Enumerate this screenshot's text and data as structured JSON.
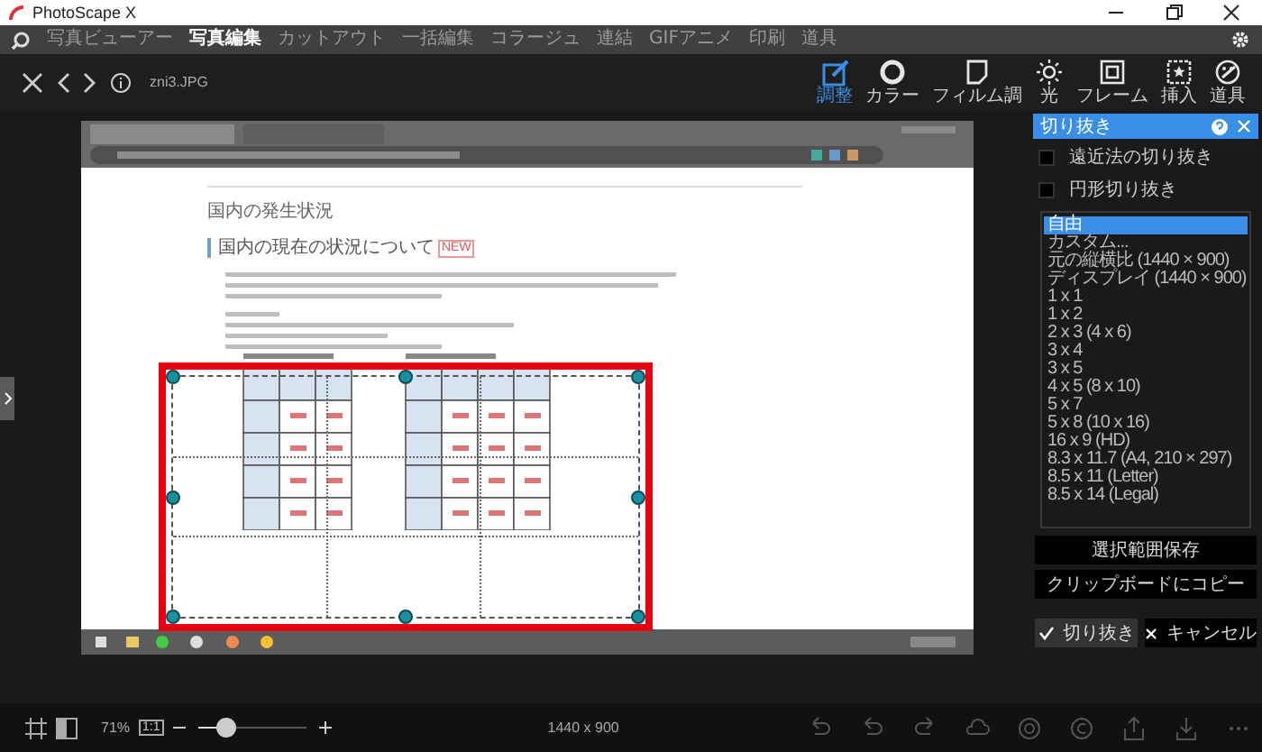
{
  "window": {
    "title": "PhotoScape X"
  },
  "menu": [
    {
      "label": "写真ビューアー",
      "selected": false
    },
    {
      "label": "写真編集",
      "selected": true
    },
    {
      "label": "カットアウト",
      "selected": false
    },
    {
      "label": "一括編集",
      "selected": false
    },
    {
      "label": "コラージュ",
      "selected": false
    },
    {
      "label": "連結",
      "selected": false
    },
    {
      "label": "GIFアニメ",
      "selected": false
    },
    {
      "label": "印刷",
      "selected": false
    },
    {
      "label": "道具",
      "selected": false
    }
  ],
  "toolbar": {
    "filename": "zni3.JPG",
    "tools": [
      {
        "kind": "adjust",
        "label": "調整",
        "selected": true
      },
      {
        "kind": "color",
        "label": "カラー",
        "selected": false
      },
      {
        "kind": "film",
        "label": "フィルム調",
        "selected": false
      },
      {
        "kind": "light",
        "label": "光",
        "selected": false
      },
      {
        "kind": "frame",
        "label": "フレーム",
        "selected": false
      },
      {
        "kind": "insert",
        "label": "挿入",
        "selected": false
      },
      {
        "kind": "tools",
        "label": "道具",
        "selected": false
      }
    ]
  },
  "image": {
    "heading": "国内の発生状況",
    "subheading": "国内の現在の状況について",
    "badge": "NEW"
  },
  "crop_panel": {
    "title": "切り抜き",
    "options": [
      {
        "label": "遠近法の切り抜き",
        "checked": false
      },
      {
        "label": "円形切り抜き",
        "checked": false
      }
    ],
    "presets": [
      {
        "label": "自由",
        "selected": true
      },
      {
        "label": "カスタム...",
        "selected": false
      },
      {
        "label": "元の縦横比 (1440 × 900)",
        "selected": false
      },
      {
        "label": "ディスプレイ (1440 × 900)",
        "selected": false
      },
      {
        "label": "1 x 1",
        "selected": false
      },
      {
        "label": "1 x 2",
        "selected": false
      },
      {
        "label": "2 x 3 (4 x 6)",
        "selected": false
      },
      {
        "label": "3 x 4",
        "selected": false
      },
      {
        "label": "3 x 5",
        "selected": false
      },
      {
        "label": "4 x 5 (8 x 10)",
        "selected": false
      },
      {
        "label": "5 x 7",
        "selected": false
      },
      {
        "label": "5 x 8 (10 x 16)",
        "selected": false
      },
      {
        "label": "16 x 9 (HD)",
        "selected": false
      },
      {
        "label": "8.3 x 11.7 (A4, 210 × 297)",
        "selected": false
      },
      {
        "label": "8.5 x 11 (Letter)",
        "selected": false
      },
      {
        "label": "8.5 x 14 (Legal)",
        "selected": false
      }
    ],
    "actions": [
      "選択範囲保存",
      "クリップボードにコピー"
    ],
    "confirm": "切り抜き",
    "cancel": "キャンセル"
  },
  "status_bar": {
    "zoom": "71%",
    "actual_size": "1:1",
    "zoom_slider": {
      "level": 0.25
    },
    "dimensions": "1440 x 900"
  }
}
